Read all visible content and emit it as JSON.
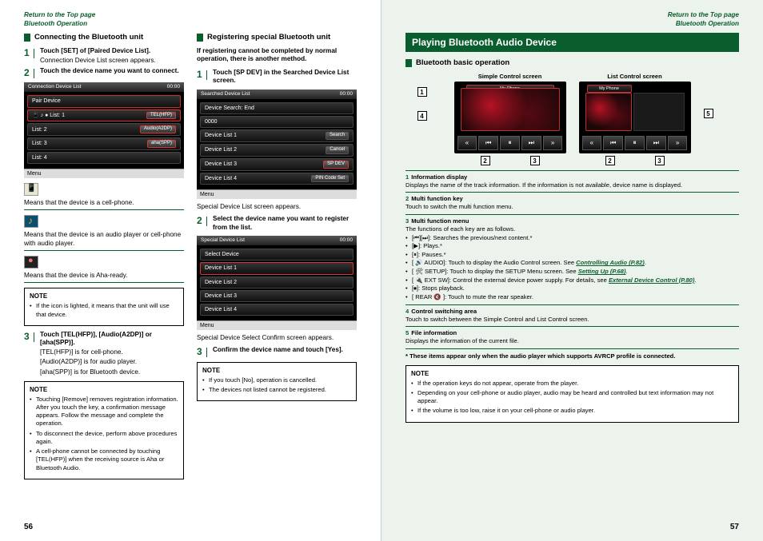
{
  "nav": {
    "return": "Return to the Top page",
    "section": "Bluetooth Operation"
  },
  "page_left_number": "56",
  "page_right_number": "57",
  "left": {
    "col1": {
      "heading": "Connecting the Bluetooth unit",
      "step1": {
        "title": "Touch [SET] of [Paired Device List].",
        "desc": "Connection Device List screen appears."
      },
      "step2": {
        "title": "Touch the device name you want to connect."
      },
      "shot_title": "Connection Device List",
      "shot_sub": "Pair Device",
      "dev1": "List: 1",
      "dev2": "List: 2",
      "dev3": "List: 3",
      "dev4": "List: 4",
      "btn_tel": "TEL(HFP)",
      "btn_audio": "Audio(A2DP)",
      "btn_aha": "aha(SPP)",
      "menu": "Menu",
      "means_phone": "Means that the device is a cell-phone.",
      "means_audio": "Means that the device is an audio player or cell-phone with audio player.",
      "means_aha": "Means that the device is Aha-ready.",
      "note1": {
        "title": "NOTE",
        "i1": "If the icon is lighted, it means that the unit will use that device."
      },
      "step3": {
        "title": "Touch [TEL(HFP)], [Audio(A2DP)] or [aha(SPP)].",
        "d1": "[TEL(HFP)] is for cell-phone.",
        "d2": "[Audio(A2DP)] is for audio player.",
        "d3": "[aha(SPP)] is for Bluetooth device."
      },
      "note2": {
        "title": "NOTE",
        "i1": "Touching [Remove] removes registration information. After you touch the key, a confirmation message appears. Follow the message and complete the operation.",
        "i2": "To disconnect the device, perform above procedures again.",
        "i3": "A cell-phone cannot be connected by touching [TEL(HFP)] when the receiving source is Aha or Bluetooth Audio."
      }
    },
    "col2": {
      "heading": "Registering special Bluetooth unit",
      "intro": "If registering cannot be completed by normal operation, there is another method.",
      "step1": {
        "title": "Touch [SP DEV] in the Searched Device List screen."
      },
      "shot1_title": "Searched Device List",
      "shot1_sub": "Device Search: End",
      "s1_r0": "0000",
      "s1_r1": "Device List 1",
      "s1_r2": "Device List 2",
      "s1_r3": "Device List 3",
      "s1_r4": "Device List 4",
      "btn_search": "Search",
      "btn_cancel": "Cancel",
      "btn_spdev": "SP DEV",
      "btn_pin": "PIN Code Set",
      "menu": "Menu",
      "after1": "Special Device List screen appears.",
      "step2": {
        "title": "Select the device name you want to register from the list."
      },
      "shot2_title": "Special Device List",
      "shot2_sub": "Select Device",
      "after2": "Special Device Select Confirm screen appears.",
      "step3": {
        "title": "Confirm the device name and touch [Yes]."
      },
      "note": {
        "title": "NOTE",
        "i1": "If you touch [No], operation is cancelled.",
        "i2": "The devices not listed cannot be registered."
      }
    }
  },
  "right": {
    "title": "Playing Bluetooth Audio Device",
    "subheading": "Bluetooth basic operation",
    "cap1": "Simple Control screen",
    "cap2": "List Control screen",
    "phone_track": "My Phone",
    "callouts": {
      "c1": "1",
      "c2": "2",
      "c3": "3",
      "c4": "4",
      "c5": "5"
    },
    "rows": {
      "r1": {
        "head": "Information display",
        "num": "1",
        "desc": "Displays the name of the track information. If the information is not available, device name is displayed."
      },
      "r2": {
        "head": "Multi function key",
        "num": "2",
        "desc": "Touch to switch the multi function menu."
      },
      "r3": {
        "head": "Multi function menu",
        "num": "3",
        "desc": "The functions of each key are as follows.",
        "i1": "[⏮][⏭]: Searches the previous/next content.*",
        "i2": "[▶]: Plays.*",
        "i3": "[⏸]: Pauses.*",
        "i4a": "[ 🔊 AUDIO]: Touch to display the Audio Control screen. See ",
        "i4b": "Controlling Audio (P.82)",
        "i5a": "[ 🛠 SETUP]: Touch to display the SETUP Menu screen. See ",
        "i5b": "Setting Up (P.68)",
        "i6a": "[ 🔌 EXT SW]: Control the external device power supply. For details, see ",
        "i6b": "External Device Control (P.80)",
        "i7": "[⏹]: Stops playback.",
        "i8": "[ REAR 🔇 ]: Touch to mute the rear speaker."
      },
      "r4": {
        "head": "Control switching area",
        "num": "4",
        "desc": "Touch to switch between the Simple Control and List Control screen."
      },
      "r5": {
        "head": "File information",
        "num": "5",
        "desc": "Displays the information of the current file."
      }
    },
    "footnote": "* These items appear only when the audio player which supports AVRCP profile is connected.",
    "note": {
      "title": "NOTE",
      "i1": "If the operation keys do not appear, operate from the player.",
      "i2": "Depending on your cell-phone or audio player, audio may be heard and controlled but text information may not appear.",
      "i3": "If the volume is too low, raise it on your cell-phone or audio player."
    }
  }
}
